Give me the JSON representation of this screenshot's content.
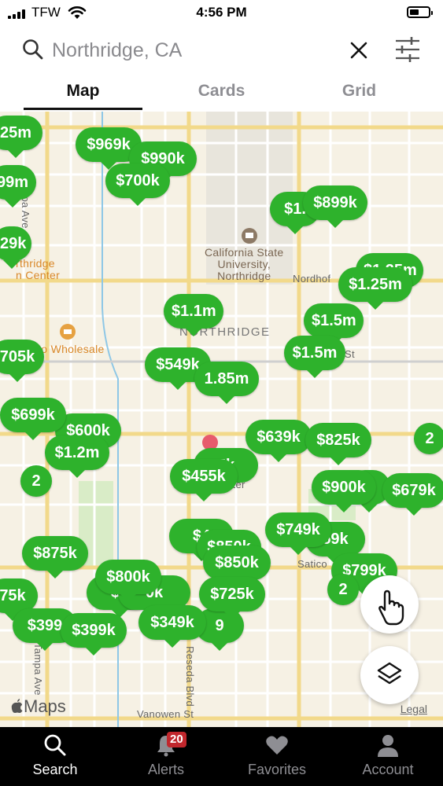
{
  "status_bar": {
    "carrier": "TFW",
    "time": "4:56 PM"
  },
  "search": {
    "query": "Northridge, CA"
  },
  "tabs": [
    "Map",
    "Cards",
    "Grid"
  ],
  "map": {
    "labels": {
      "tampa_ave_top": "Tampa Ave",
      "tampa_ave_bottom": "Tampa Ave",
      "reseda_blvd": "Reseda Blvd",
      "vanowen_st": "Vanowen St",
      "nordhoff": "Nordhof",
      "saticoy": "Satico",
      "st": "St",
      "northridge": "NORTHRIDGE",
      "csun": "California State\nUniversity,\nNorthridge",
      "costco": "co Wholesale",
      "fashion_center": "rthridge\nn Center",
      "center": "nter"
    },
    "pins": [
      "25m",
      "$969k",
      "$990k",
      "99m",
      "$700k",
      "$1.",
      "$899k",
      "29k",
      "$1.25m",
      "$1.25m",
      "$1.1m",
      "$1.5m",
      "705k",
      "$1.5m",
      "$549k",
      "1.85m",
      "$600k",
      "$699k",
      "$639k",
      "$825k",
      "$1.2m",
      "5k",
      "$455k",
      "$900k",
      "k",
      "$679k",
      "$4",
      "$749k",
      "59k",
      "$875k",
      "$850k",
      "$800k",
      "0k",
      "$799k",
      "$9",
      "75k",
      "$725k",
      "9",
      "$399",
      "$399k",
      "$349k"
    ],
    "clusters": [
      "2",
      "2",
      "2"
    ],
    "attribution": "Maps",
    "legal": "Legal"
  },
  "bottom_nav": {
    "items": [
      {
        "label": "Search"
      },
      {
        "label": "Alerts",
        "badge": "20"
      },
      {
        "label": "Favorites"
      },
      {
        "label": "Account"
      }
    ]
  },
  "colors": {
    "pin": "#2eb22c",
    "badge": "#c1272d",
    "nav_bg": "#000000",
    "map_bg": "#f6f1e4"
  },
  "icons": [
    "search-icon",
    "close-icon",
    "filter-sliders-icon",
    "hand-pointer-icon",
    "layers-icon",
    "magnifier-icon",
    "bell-icon",
    "heart-icon",
    "person-icon",
    "apple-logo-icon",
    "signal-icon",
    "wifi-icon",
    "battery-icon"
  ]
}
